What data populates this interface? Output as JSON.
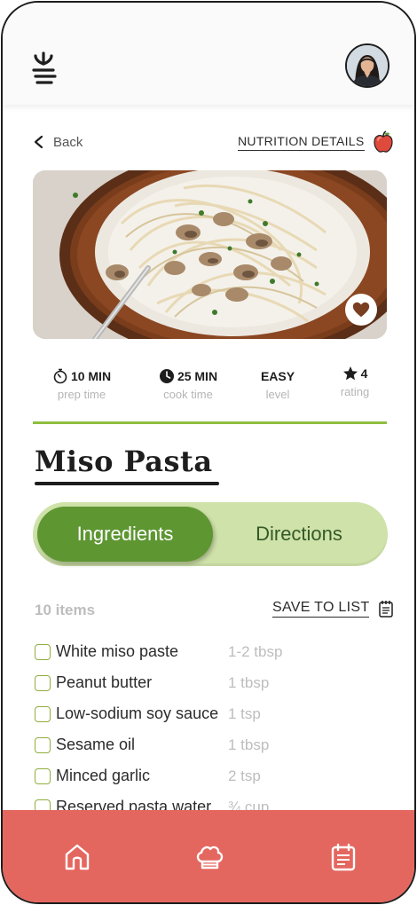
{
  "header": {
    "menu_icon": "sprout-menu-icon",
    "avatar_icon": "user-avatar"
  },
  "nav": {
    "back_label": "Back",
    "nutrition_label": "NUTRITION DETAILS",
    "nutrition_icon": "apple-icon"
  },
  "hero": {
    "favorite_icon": "heart-icon"
  },
  "stats": [
    {
      "icon": "stopwatch-icon",
      "value": "10 MIN",
      "label": "prep time"
    },
    {
      "icon": "clock-icon",
      "value": "25 MIN",
      "label": "cook time"
    },
    {
      "icon": "",
      "value": "EASY",
      "label": "level"
    },
    {
      "icon": "star-icon",
      "value": "4",
      "label": "rating"
    }
  ],
  "recipe": {
    "title": "Miso Pasta"
  },
  "tabs": {
    "active": "Ingredients",
    "inactive": "Directions"
  },
  "ingredients": {
    "count": "10 items",
    "save_label": "SAVE TO LIST",
    "save_icon": "notepad-icon",
    "items": [
      {
        "name": "White miso paste",
        "qty": "1-2 tbsp"
      },
      {
        "name": "Peanut butter",
        "qty": "1 tbsp"
      },
      {
        "name": "Low-sodium soy sauce",
        "qty": "1 tsp"
      },
      {
        "name": "Sesame oil",
        "qty": "1 tbsp"
      },
      {
        "name": "Minced garlic",
        "qty": "2 tsp"
      },
      {
        "name": "Reserved pasta water",
        "qty": "¾ cup"
      }
    ]
  },
  "bottom_nav": {
    "items": [
      "home-icon",
      "chef-hat-icon",
      "calendar-icon"
    ]
  },
  "colors": {
    "accent_green": "#5e9632",
    "light_green": "#cfe2a9",
    "divider_green": "#8fbe3e",
    "nav_red": "#e4675f"
  }
}
